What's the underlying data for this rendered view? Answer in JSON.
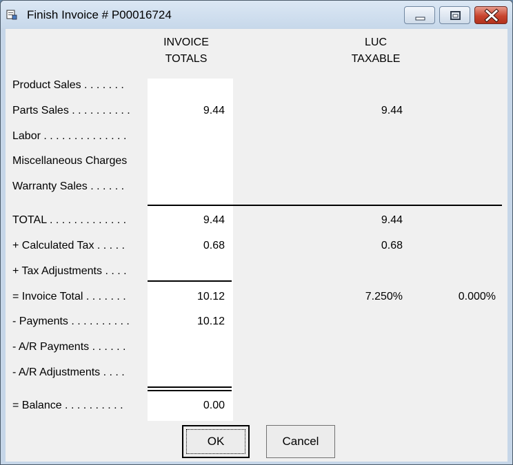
{
  "window": {
    "title": "Finish Invoice # P00016724",
    "icon": "invoice-app-icon",
    "controls": [
      "minimize-icon",
      "maximize-icon",
      "close-icon"
    ]
  },
  "headers": {
    "invoice_line1": "INVOICE",
    "invoice_line2": "TOTALS",
    "luc_line1": "LUC",
    "luc_line2": "TAXABLE"
  },
  "rows": [
    {
      "label": "Product Sales . . . . . . .",
      "invoice": "",
      "luc": "",
      "other": ""
    },
    {
      "label": "Parts Sales . . . . . . . . . .",
      "invoice": "9.44",
      "luc": "9.44",
      "other": ""
    },
    {
      "label": "Labor . . . . . . . . . . . . . .",
      "invoice": "",
      "luc": "",
      "other": ""
    },
    {
      "label": "Miscellaneous Charges",
      "invoice": "",
      "luc": "",
      "other": ""
    },
    {
      "label": "Warranty Sales . . . . . .",
      "invoice": "",
      "luc": "",
      "other": ""
    },
    {
      "label": "TOTAL . . . . . . . . . . . . .",
      "invoice": "9.44",
      "luc": "9.44",
      "other": ""
    },
    {
      "label": "+ Calculated Tax . . . . .",
      "invoice": "0.68",
      "luc": "0.68",
      "other": ""
    },
    {
      "label": "+ Tax Adjustments . . . .",
      "invoice": "",
      "luc": "",
      "other": ""
    },
    {
      "label": "= Invoice Total . . . . . . .",
      "invoice": "10.12",
      "luc": "7.250%",
      "other": "0.000%"
    },
    {
      "label": "- Payments . . . . . . . . . .",
      "invoice": "10.12",
      "luc": "",
      "other": ""
    },
    {
      "label": "- A/R Payments . . . . . .",
      "invoice": "",
      "luc": "",
      "other": ""
    },
    {
      "label": "- A/R Adjustments . . . .",
      "invoice": "",
      "luc": "",
      "other": ""
    },
    {
      "label": "= Balance . . . . . . . . . .",
      "invoice": "0.00",
      "luc": "",
      "other": ""
    }
  ],
  "buttons": {
    "ok": "OK",
    "cancel": "Cancel"
  },
  "colors": {
    "title_bar": "#c7d8ea",
    "close_button": "#c8452f",
    "dialog_background": "#f0f0f0",
    "totals_column": "#ffffff"
  }
}
